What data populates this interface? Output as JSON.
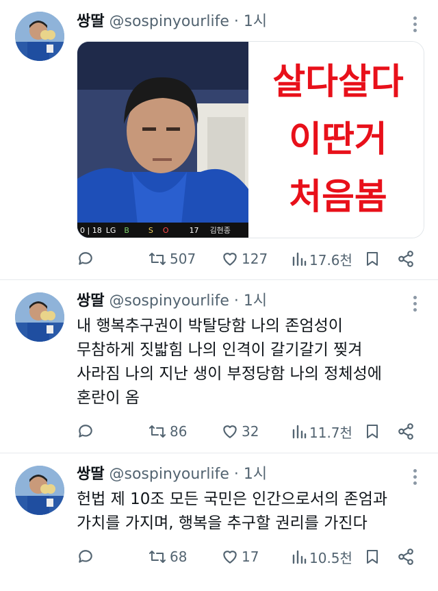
{
  "tweets": [
    {
      "name": "쌍딸",
      "handle": "@sospinyourlife",
      "sep": "·",
      "time": "1시",
      "media": {
        "caption_lines": [
          "살다살다",
          "이딴거",
          "처음봄"
        ],
        "scorebar": {
          "score": "0 | 18",
          "team": "LG",
          "b": "B",
          "s": "S",
          "o": "O",
          "inning": "17",
          "player": "김현종"
        }
      },
      "replies": "",
      "retweets": "507",
      "likes": "127",
      "views": "17.6천"
    },
    {
      "name": "쌍딸",
      "handle": "@sospinyourlife",
      "sep": "·",
      "time": "1시",
      "text_lines": [
        "내 행복추구권이 박탈당함 나의 존엄성이",
        "무참하게 짓밟힘 나의 인격이 갈기갈기 찢겨",
        "사라짐 나의 지난 생이 부정당함 나의 정체성에",
        "혼란이 옴"
      ],
      "replies": "",
      "retweets": "86",
      "likes": "32",
      "views": "11.7천"
    },
    {
      "name": "쌍딸",
      "handle": "@sospinyourlife",
      "sep": "·",
      "time": "1시",
      "text_lines": [
        "헌법 제 10조 모든 국민은 인간으로서의 존엄과",
        "가치를 가지며, 행복을 추구할 권리를 가진다"
      ],
      "replies": "",
      "retweets": "68",
      "likes": "17",
      "views": "10.5천"
    }
  ],
  "icons": [
    "reply-icon",
    "retweet-icon",
    "like-icon",
    "views-icon",
    "bookmark-icon",
    "share-icon",
    "more-icon"
  ],
  "colors": {
    "text": "#0f1419",
    "secondary": "#536471",
    "divider": "#e6e9ec",
    "caption_red": "#e8101a"
  }
}
